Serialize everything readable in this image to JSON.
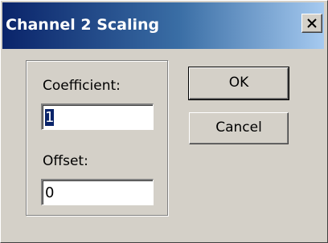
{
  "window": {
    "title": "Channel 2 Scaling"
  },
  "form": {
    "coefficient_label": "Coefficient:",
    "coefficient_value": "1",
    "offset_label": "Offset:",
    "offset_value": "0"
  },
  "buttons": {
    "ok_label": "OK",
    "cancel_label": "Cancel"
  },
  "icons": {
    "close": "close-icon"
  },
  "colors": {
    "titlebar_start": "#0a246a",
    "titlebar_end": "#a6caf0",
    "face": "#d4d0c8",
    "selection": "#0a246a"
  }
}
